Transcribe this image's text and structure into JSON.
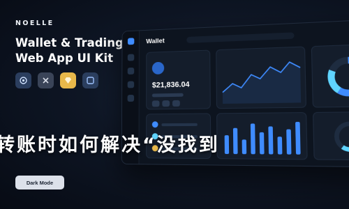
{
  "brand": {
    "name": "NOELLE"
  },
  "headline": {
    "line1": "Wallet & Trading",
    "line2": "Web App UI Kit"
  },
  "tools": [
    {
      "icon": "figma-icon",
      "color": "#2b3e5e"
    },
    {
      "icon": "xd-icon",
      "color": "#3a4458"
    },
    {
      "icon": "sketch-icon",
      "color": "#e8b84a"
    },
    {
      "icon": "photoshop-icon",
      "color": "#2b3e5e"
    }
  ],
  "mockup": {
    "title": "Wallet",
    "balance": "$21,836.04"
  },
  "caption": "转账时如何解决“没找到",
  "mode_toggle": {
    "label": "Dark Mode"
  },
  "colors": {
    "accent": "#3f8cff",
    "background": "#0e1625",
    "pill": "#dce1ea"
  }
}
